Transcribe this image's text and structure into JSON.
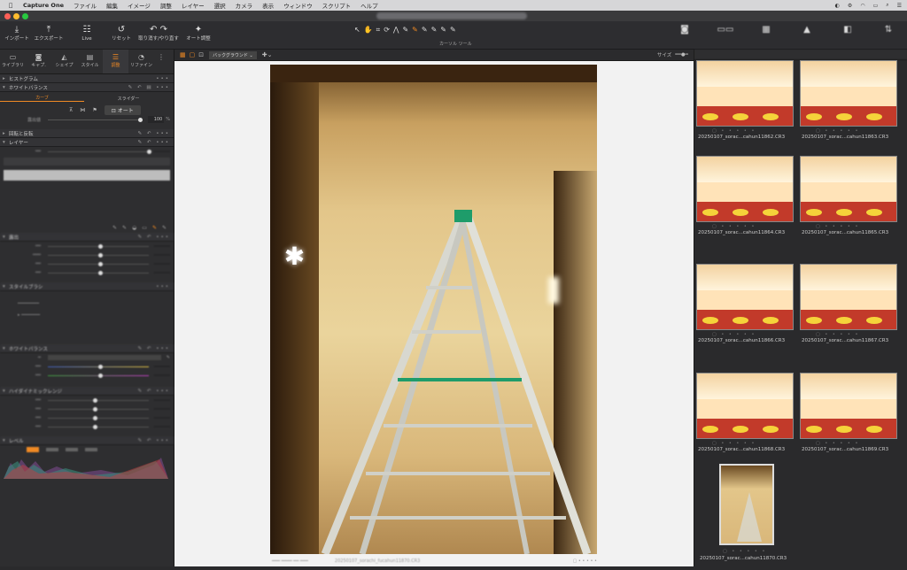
{
  "menubar": {
    "app": "Capture One",
    "items": [
      "ファイル",
      "編集",
      "イメージ",
      "調整",
      "レイヤー",
      "選択",
      "カメラ",
      "表示",
      "ウィンドウ",
      "スクリプト",
      "ヘルプ"
    ]
  },
  "toolbar": {
    "import": "インポート",
    "export": "エクスポート",
    "live": "Live",
    "reset": "リセット",
    "undo_redo": "取り消す/やり直す",
    "auto": "オート調整",
    "cursor_tools": "カーソル ツール"
  },
  "tool_tabs": [
    "ライブラリ",
    "キャプ.",
    "シェイプ",
    "スタイル",
    "調整",
    "リファイン"
  ],
  "left": {
    "histogram": "ヒストグラム",
    "curve": "ホワイトバランス",
    "curve_tab1": "カーブ",
    "curve_tab2": "スライダー",
    "auto_btn": "オート",
    "exposure_label": "露出値",
    "exposure_value": "100",
    "rotate": "回転と反転",
    "layers": "レイヤー",
    "section_levels": "露出",
    "section_style": "スタイルブラシ",
    "section_hdr": "ハイダイナミックレンジ",
    "section_wb": "ホワイトバランス",
    "section_levels2": "レベル"
  },
  "viewer": {
    "background_select": "バックグラウンド",
    "size_label": "サイズ",
    "caption_name": "20250107_sorachi_fucahun11870.CR3"
  },
  "filmstrip": {
    "files": [
      "20250107_sorac...cahun11862.CR3",
      "20250107_sorac...cahun11863.CR3",
      "20250107_sorac...cahun11864.CR3",
      "20250107_sorac...cahun11865.CR3",
      "20250107_sorac...cahun11866.CR3",
      "20250107_sorac...cahun11867.CR3",
      "20250107_sorac...cahun11868.CR3",
      "20250107_sorac...cahun11869.CR3",
      "20250107_sorac...cahun11870.CR3"
    ]
  },
  "colors": {
    "accent": "#f08a24",
    "ladder": "#d8d8d0",
    "tape": "#1e9c6a"
  }
}
